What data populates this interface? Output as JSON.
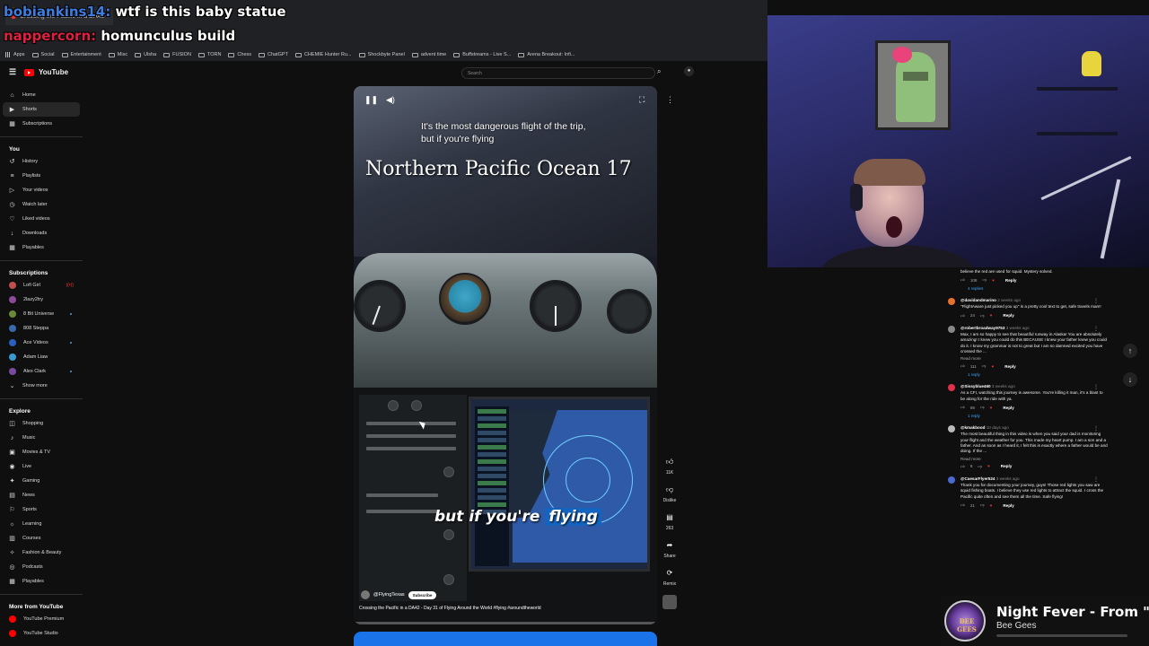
{
  "chat": [
    {
      "user": "bobiankins14:",
      "message": " wtf is this baby statue"
    },
    {
      "user": "nappercorn:",
      "message": " homunculus build"
    }
  ],
  "browser": {
    "tab_title": "Crossing the Pacific in a DA42",
    "bookmarks": [
      "Apps",
      "Social",
      "Entertainment",
      "Misc",
      "Ulsha",
      "FUSION",
      "TORN",
      "Chess",
      "ChatGPT",
      "CHEMIE Hunter Ru...",
      "Shockbyte Panel",
      "advent time",
      "Buffstreams - Live S...",
      "Arena Breakout: Infi..."
    ]
  },
  "youtube": {
    "logo_text": "YouTube",
    "search_placeholder": "Search",
    "nav": [
      {
        "label": "Home",
        "icon": "home-icon",
        "glyph": "⌂"
      },
      {
        "label": "Shorts",
        "icon": "shorts-icon",
        "glyph": "▶",
        "active": true
      },
      {
        "label": "Subscriptions",
        "icon": "subscriptions-icon",
        "glyph": "▦"
      }
    ],
    "you_header": "You",
    "you_items": [
      {
        "label": "History",
        "icon": "history-icon",
        "glyph": "↺"
      },
      {
        "label": "Playlists",
        "icon": "playlists-icon",
        "glyph": "≡"
      },
      {
        "label": "Your videos",
        "icon": "your-videos-icon",
        "glyph": "▷"
      },
      {
        "label": "Watch later",
        "icon": "watch-later-icon",
        "glyph": "◷"
      },
      {
        "label": "Liked videos",
        "icon": "liked-videos-icon",
        "glyph": "♡"
      },
      {
        "label": "Downloads",
        "icon": "downloads-icon",
        "glyph": "↓"
      },
      {
        "label": "Playables",
        "icon": "playables-icon",
        "glyph": "▦"
      }
    ],
    "subs_header": "Subscriptions",
    "subscriptions": [
      {
        "label": "Lofi Girl",
        "color": "#c0504d",
        "badge": "live"
      },
      {
        "label": "2lazy2try",
        "color": "#8c4a9a"
      },
      {
        "label": "8 Bit Universe",
        "color": "#6a8a3a",
        "badge": "dot"
      },
      {
        "label": "808 Steppa",
        "color": "#3a6aaa"
      },
      {
        "label": "Ace Videos",
        "color": "#2a5fc0",
        "badge": "dot"
      },
      {
        "label": "Adam Liaw",
        "color": "#3a9ad0"
      },
      {
        "label": "Alex Clark",
        "color": "#7a4aa0",
        "badge": "dot"
      }
    ],
    "show_more": "Show more",
    "explore_header": "Explore",
    "explore": [
      {
        "label": "Shopping",
        "icon": "shopping-icon",
        "glyph": "◫"
      },
      {
        "label": "Music",
        "icon": "music-icon",
        "glyph": "♪"
      },
      {
        "label": "Movies & TV",
        "icon": "movies-icon",
        "glyph": "▣"
      },
      {
        "label": "Live",
        "icon": "live-icon",
        "glyph": "◉"
      },
      {
        "label": "Gaming",
        "icon": "gaming-icon",
        "glyph": "✦"
      },
      {
        "label": "News",
        "icon": "news-icon",
        "glyph": "▤"
      },
      {
        "label": "Sports",
        "icon": "sports-icon",
        "glyph": "⚐"
      },
      {
        "label": "Learning",
        "icon": "learning-icon",
        "glyph": "☼"
      },
      {
        "label": "Courses",
        "icon": "courses-icon",
        "glyph": "▥"
      },
      {
        "label": "Fashion & Beauty",
        "icon": "fashion-icon",
        "glyph": "✧"
      },
      {
        "label": "Podcasts",
        "icon": "podcasts-icon",
        "glyph": "◎"
      },
      {
        "label": "Playables",
        "icon": "playables2-icon",
        "glyph": "▦"
      }
    ],
    "more_header": "More from YouTube",
    "more": [
      {
        "label": "YouTube Premium",
        "color": "#f00"
      },
      {
        "label": "YouTube Studio",
        "color": "#f00"
      }
    ]
  },
  "short": {
    "overlay_text": "It's the most dangerous flight of the trip, but if you're flying",
    "title_overlay": "Northern Pacific Ocean 17",
    "caption_main": "but if you're ",
    "caption_highlight": "flying",
    "channel": "@FlyingTexas",
    "subscribe": "Subscribe",
    "video_title": "Crossing the Pacific in a DA42 - Day 31 of Flying Around the World #flying #aroundtheworld",
    "progress": 0.0,
    "actions": {
      "likes": "11K",
      "dislike": "Dislike",
      "comments": "263",
      "share": "Share",
      "remix": "Remix"
    }
  },
  "comments": [
    {
      "pre_text": "believe the red are used for squid. Mystery solved.",
      "likes": "108",
      "reply": "Reply",
      "replies": "4 replies"
    },
    {
      "user": "@davidandmarino",
      "date": "2 weeks ago",
      "text": "\"FlightAware just picked you up\" is a pretty cool text to get, safe travels man!!",
      "likes": "24",
      "reply": "Reply",
      "color": "#e8702a"
    },
    {
      "user": "@robertbroadway9753",
      "date": "3 weeks ago",
      "text": "Max, I am so happy to see that beautiful runway in Alaska! You are absolutely amazing! I knew you could do this BECAUSE I knew your father knew you could do it. I know my grammar is not to great but I am so damned excited you have crossed the ...",
      "more": "Read more",
      "likes": "111",
      "reply": "Reply",
      "replies": "1 reply",
      "color": "#888"
    },
    {
      "user": "@Sissyblue460",
      "date": "3 weeks ago",
      "text": "As a CFI, watching this journey is awesome. You're killing it man, it's a blast to be along for the ride with ya.",
      "likes": "69",
      "reply": "Reply",
      "replies": "1 reply",
      "color": "#e0304a"
    },
    {
      "user": "@kmakbood",
      "date": "10 days ago",
      "text": "The most beautiful thing in this video is when you said your dad is monitoring your flight and the weather for you. This made my heart pump. I am a son and a father. And as soon as I heard it, I felt this is exactly where a father would be and doing. If the ...",
      "more": "Read more",
      "likes": "8",
      "reply": "Reply",
      "color": "#bbb"
    },
    {
      "user": "@CaesarFlyer524",
      "date": "3 weeks ago",
      "text": "Thank you for documenting your journey, guys! Those red lights you saw are squid fishing boats. I believe they use red lights to attract the squid. I cross the Pacific quite often and see them all the time. Safe flying!",
      "likes": "21",
      "reply": "Reply",
      "color": "#4a6ad0"
    }
  ],
  "music": {
    "title": "Night Fever - From \"S...",
    "artist": "Bee Gees",
    "album_text": "BEE GEES",
    "progress": 0.0
  }
}
